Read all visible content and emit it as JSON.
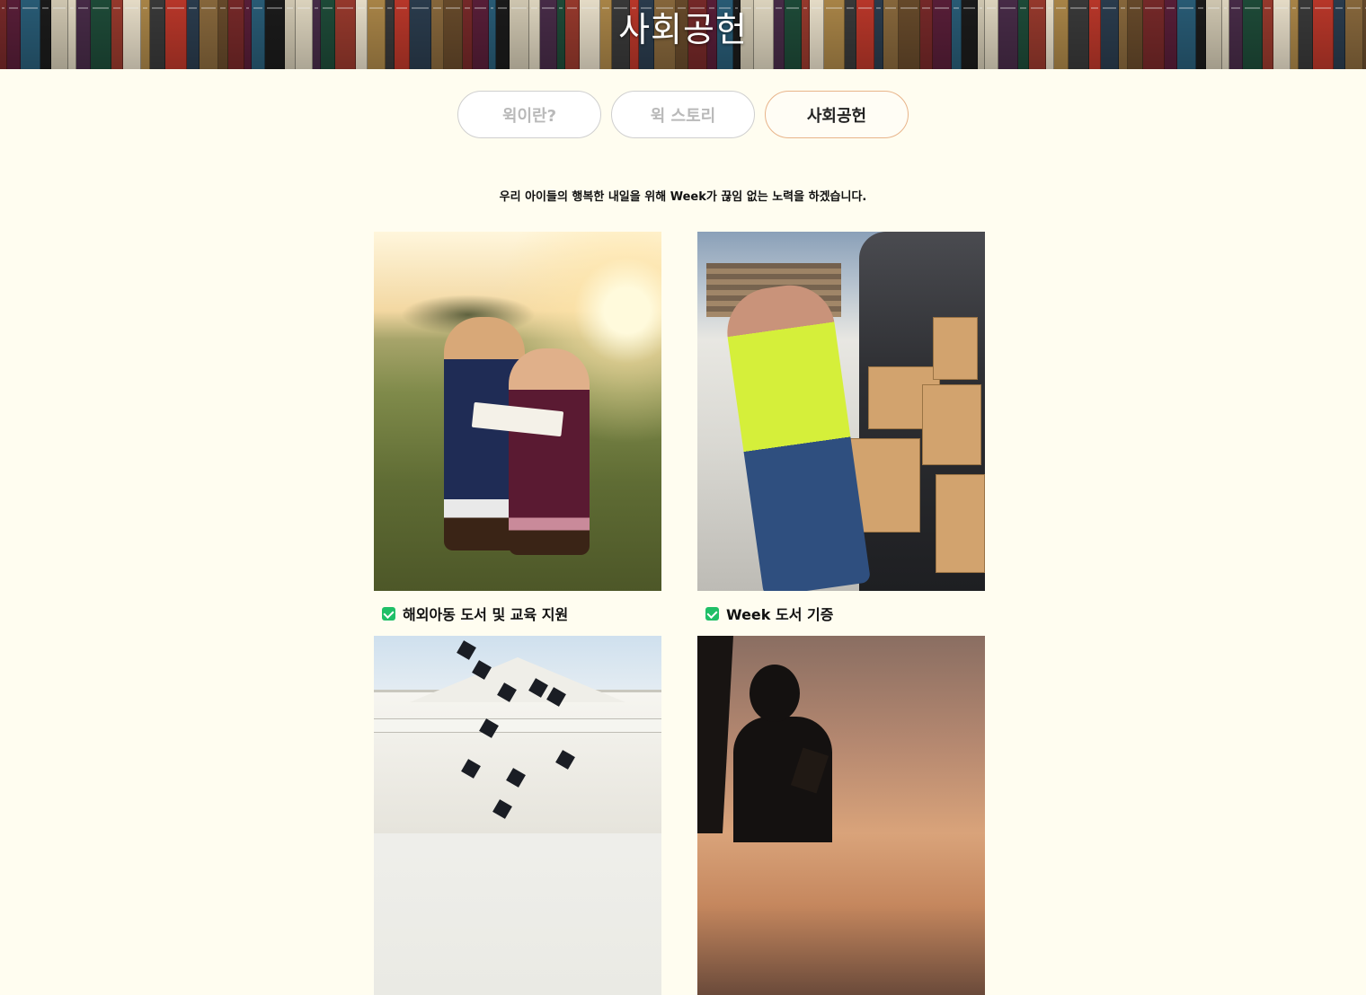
{
  "hero": {
    "title": "사회공헌"
  },
  "tabs": [
    {
      "label": "윅이란?",
      "active": false
    },
    {
      "label": "윅 스토리",
      "active": false
    },
    {
      "label": "사회공헌",
      "active": true
    }
  ],
  "intro": "우리 아이들의 행복한 내일을 위해 Week가 끊임 없는 노력을 하겠습니다.",
  "cards": [
    {
      "caption": "해외아동 도서 및 교육 지원",
      "icon": "check-icon"
    },
    {
      "caption": "Week 도서 기증",
      "icon": "check-icon"
    }
  ],
  "colors": {
    "background": "#fffdf0",
    "active_tab_border": "#e8b48a",
    "check": "#1fbf67"
  }
}
